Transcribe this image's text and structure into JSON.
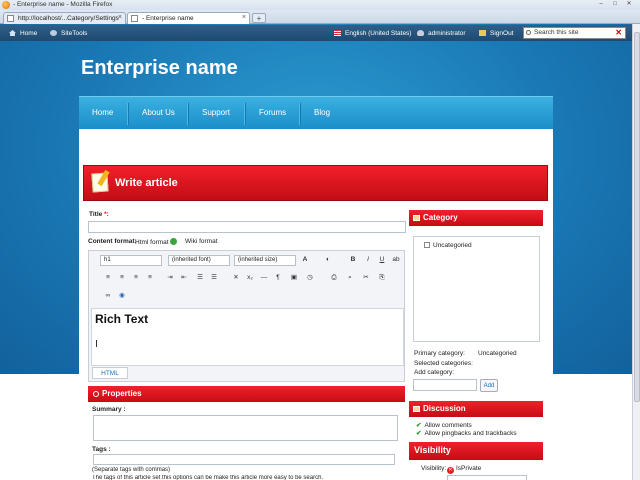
{
  "browser": {
    "window_title": "- Enterprise name - Mozilla Firefox",
    "tabs": [
      {
        "label": "http://localhost/...Category/Settings"
      },
      {
        "label": "- Enterprise name"
      }
    ],
    "new_tab": "+"
  },
  "adminbar": {
    "home": "Home",
    "sitetools": "SiteTools",
    "language": "English (United States)",
    "user": "administrator",
    "signout": "SignOut",
    "search_placeholder": "Search this site"
  },
  "site": {
    "title": "Enterprise name"
  },
  "nav": {
    "items": [
      "Home",
      "About Us",
      "Support",
      "Forums",
      "Blog"
    ]
  },
  "write": {
    "header": "Write article",
    "title_label": "Title",
    "required_mark": "*",
    "title_colon": ":",
    "content_format_label": "Content format:",
    "format_html": "Html format",
    "format_wiki": "Wiki format"
  },
  "editor": {
    "block_format": "h1",
    "font": "(inherited font)",
    "size": "(inherited size)",
    "content_text": "Rich Text",
    "html_tab": "HTML"
  },
  "properties": {
    "header": "Properties",
    "summary_label": "Summary :",
    "tags_label": "Tags :",
    "tags_hint": "(Separate tags with commas)",
    "tags_help": "The tags of this article set this options can be make this article more easy to be search."
  },
  "category": {
    "header": "Category",
    "item": "Uncategoried",
    "primary_label": "Primary category:",
    "primary_value": "Uncategoried",
    "selected_label": "Selected categories:",
    "add_label": "Add category:",
    "add_button": "Add"
  },
  "discussion": {
    "header": "Discussion",
    "allow_comments": "Allow comments",
    "allow_pingbacks": "Allow pingbacks and trackbacks"
  },
  "visibility": {
    "header": "Visibility",
    "label": "Visibility:",
    "value": "IsPrivate"
  },
  "colors": {
    "accent_red": "#e01820",
    "nav_blue": "#1b8ec9",
    "page_blue": "#1a78b4"
  }
}
